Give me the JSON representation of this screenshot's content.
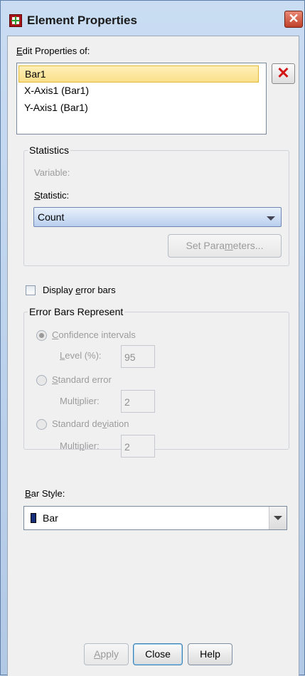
{
  "window": {
    "title": "Element Properties",
    "close_glyph": "✕"
  },
  "edit_properties": {
    "label_prefix": "",
    "label_underlined": "E",
    "label_rest": "dit Properties of:",
    "items": [
      "Bar1",
      "X-Axis1 (Bar1)",
      "Y-Axis1 (Bar1)"
    ],
    "selected_index": 0,
    "delete_glyph": "✕"
  },
  "statistics": {
    "group_title": "Statistics",
    "variable_label": "Variable:",
    "statistic_label_underlined": "S",
    "statistic_label_rest": "tatistic:",
    "statistic_value": "Count",
    "set_parameters_prefix": "Set Para",
    "set_parameters_underlined": "m",
    "set_parameters_rest": "eters..."
  },
  "display_error_bars": {
    "label_prefix": "Display ",
    "label_underlined": "e",
    "label_rest": "rror bars",
    "checked": false
  },
  "error_bars": {
    "group_title": "Error Bars Represent",
    "options": [
      {
        "prefix": "",
        "underlined": "C",
        "rest": "onfidence intervals",
        "sub_prefix": "",
        "sub_underlined": "L",
        "sub_rest": "evel (%):",
        "value": "95",
        "checked": true
      },
      {
        "prefix": "",
        "underlined": "S",
        "rest": "tandard error",
        "sub_prefix": "Mult",
        "sub_underlined": "i",
        "sub_rest": "plier:",
        "value": "2",
        "checked": false
      },
      {
        "prefix": "Standard de",
        "underlined": "v",
        "rest": "iation",
        "sub_prefix": "Multi",
        "sub_underlined": "p",
        "sub_rest": "lier:",
        "value": "2",
        "checked": false
      }
    ]
  },
  "bar_style": {
    "label_underlined": "B",
    "label_rest": "ar Style:",
    "value": "Bar",
    "swatch_color": "#16317a"
  },
  "buttons": {
    "apply_underlined": "A",
    "apply_rest": "pply",
    "close": "Close",
    "help": "Help"
  },
  "colors": {
    "selection": "#fadf8a",
    "delete": "#d21414",
    "title_close": "#c0412a"
  }
}
